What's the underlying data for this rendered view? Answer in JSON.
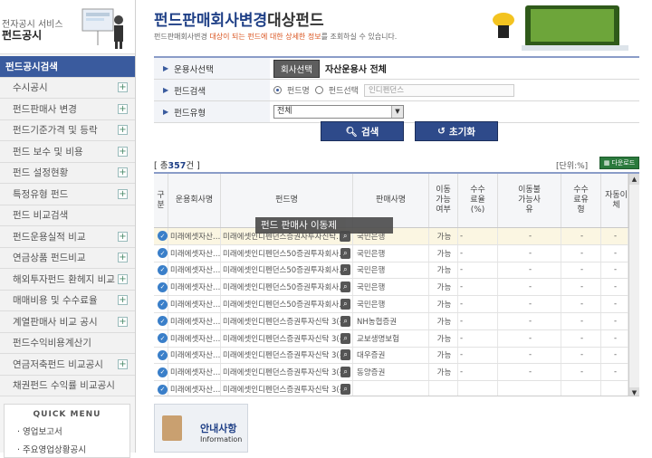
{
  "brand": {
    "subtitle": "전자공시 서비스",
    "title": "펀드공시"
  },
  "sidebar": {
    "items": [
      {
        "label": "펀드공시검색",
        "active": true
      },
      {
        "label": "수시공시",
        "plus": true
      },
      {
        "label": "펀드판매사 변경",
        "plus": true
      },
      {
        "label": "펀드기준가격 및 등락",
        "plus": true
      },
      {
        "label": "펀드 보수 및 비용",
        "plus": true
      },
      {
        "label": "펀드 설정현황",
        "plus": true
      },
      {
        "label": "특정유형 펀드",
        "plus": true
      },
      {
        "label": "펀드 비교검색",
        "plus": false
      },
      {
        "label": "펀드운용실적 비교",
        "plus": true
      },
      {
        "label": "연금상품 펀드비교",
        "plus": true
      },
      {
        "label": "해외투자펀드 환헤지 비교",
        "plus": true
      },
      {
        "label": "매매비용 및 수수료율",
        "plus": true
      },
      {
        "label": "계열판매사 비교 공시",
        "plus": true
      },
      {
        "label": "펀드수익비용계산기",
        "plus": false
      },
      {
        "label": "연금저축펀드 비교공시",
        "plus": true
      },
      {
        "label": "채권펀드 수익률 비교공시",
        "plus": false
      }
    ],
    "plus_symbol": "+",
    "quick_menu": {
      "title": "QUICK MENU",
      "items": [
        "· 영업보고서",
        "· 주요영업상황공시"
      ]
    }
  },
  "page": {
    "title_main": "펀드판매회사변경",
    "title_suffix": "대상펀드",
    "desc_a": "펀드판매회사변경 ",
    "desc_hl": "대상이 되는 펀드에 대한 상세한 정보",
    "desc_b": "를 조회하실 수 있습니다."
  },
  "form": {
    "rows": {
      "company": {
        "label": "운용사선택",
        "button": "회사선택",
        "value": "자산운용사 전체"
      },
      "fund": {
        "label": "펀드검색",
        "radio1": "펀드명",
        "radio2": "펀드선택",
        "input_value": "인디펜던스"
      },
      "type": {
        "label": "펀드유형",
        "select_value": "전체"
      }
    },
    "search_button": "검색",
    "reset_button": "초기화"
  },
  "grid": {
    "total_prefix": "[ 총",
    "total_count": "357",
    "total_suffix": "건 ]",
    "unit": "[단위:%]",
    "download": "다운로드",
    "headers": {
      "select": "구분",
      "company": "운용회사명",
      "fund": "펀드명",
      "seller": "판매사명",
      "movable": "이동가능여부",
      "fee": "수수료율(%)",
      "reason": "이동불가능사유",
      "fee_type": "수수료유형",
      "auto": "자동이체"
    },
    "rows": [
      {
        "company": "미래에셋자산…",
        "fund": "미래에셋인디펜던스증권자투자신탁…",
        "seller": "국민은행",
        "movable": "가능",
        "fee": "-",
        "reason": "-",
        "fee_type": "-",
        "auto": "-"
      },
      {
        "company": "미래에셋자산…",
        "fund": "미래에셋인디펜던스50증권투자회사…",
        "seller": "국민은행",
        "movable": "가능",
        "fee": "-",
        "reason": "-",
        "fee_type": "-",
        "auto": "-"
      },
      {
        "company": "미래에셋자산…",
        "fund": "미래에셋인디펜던스50증권투자회사…",
        "seller": "국민은행",
        "movable": "가능",
        "fee": "-",
        "reason": "-",
        "fee_type": "-",
        "auto": "-"
      },
      {
        "company": "미래에셋자산…",
        "fund": "미래에셋인디펜던스50증권투자회사…",
        "seller": "국민은행",
        "movable": "가능",
        "fee": "-",
        "reason": "-",
        "fee_type": "-",
        "auto": "-"
      },
      {
        "company": "미래에셋자산…",
        "fund": "미래에셋인디펜던스50증권투자회사…",
        "seller": "국민은행",
        "movable": "가능",
        "fee": "-",
        "reason": "-",
        "fee_type": "-",
        "auto": "-"
      },
      {
        "company": "미래에셋자산…",
        "fund": "미래에셋인디펜던스증권투자신탁 3(주…",
        "seller": "NH농협증권",
        "movable": "가능",
        "fee": "-",
        "reason": "-",
        "fee_type": "-",
        "auto": "-"
      },
      {
        "company": "미래에셋자산…",
        "fund": "미래에셋인디펜던스증권투자신탁 3(주…",
        "seller": "교보생명보험",
        "movable": "가능",
        "fee": "-",
        "reason": "-",
        "fee_type": "-",
        "auto": "-"
      },
      {
        "company": "미래에셋자산…",
        "fund": "미래에셋인디펜던스증권투자신탁 3(주…",
        "seller": "대우증권",
        "movable": "가능",
        "fee": "-",
        "reason": "-",
        "fee_type": "-",
        "auto": "-"
      },
      {
        "company": "미래에셋자산…",
        "fund": "미래에셋인디펜던스증권투자신탁 3(주…",
        "seller": "동양증권",
        "movable": "가능",
        "fee": "-",
        "reason": "-",
        "fee_type": "-",
        "auto": "-"
      },
      {
        "company": "미래에셋자산…",
        "fund": "미래에셋인디펜던스증권투자신탁 3(주…",
        "seller": "",
        "movable": "",
        "fee": "",
        "reason": "",
        "fee_type": "",
        "auto": ""
      }
    ],
    "tooltip": "펀드 판매사 이동제"
  },
  "notice": {
    "title": "안내사항",
    "subtitle": "Information"
  },
  "colors": {
    "accent": "#1e3f86",
    "sidebar_active": "#3a5b9e",
    "highlight": "#d9531e"
  }
}
